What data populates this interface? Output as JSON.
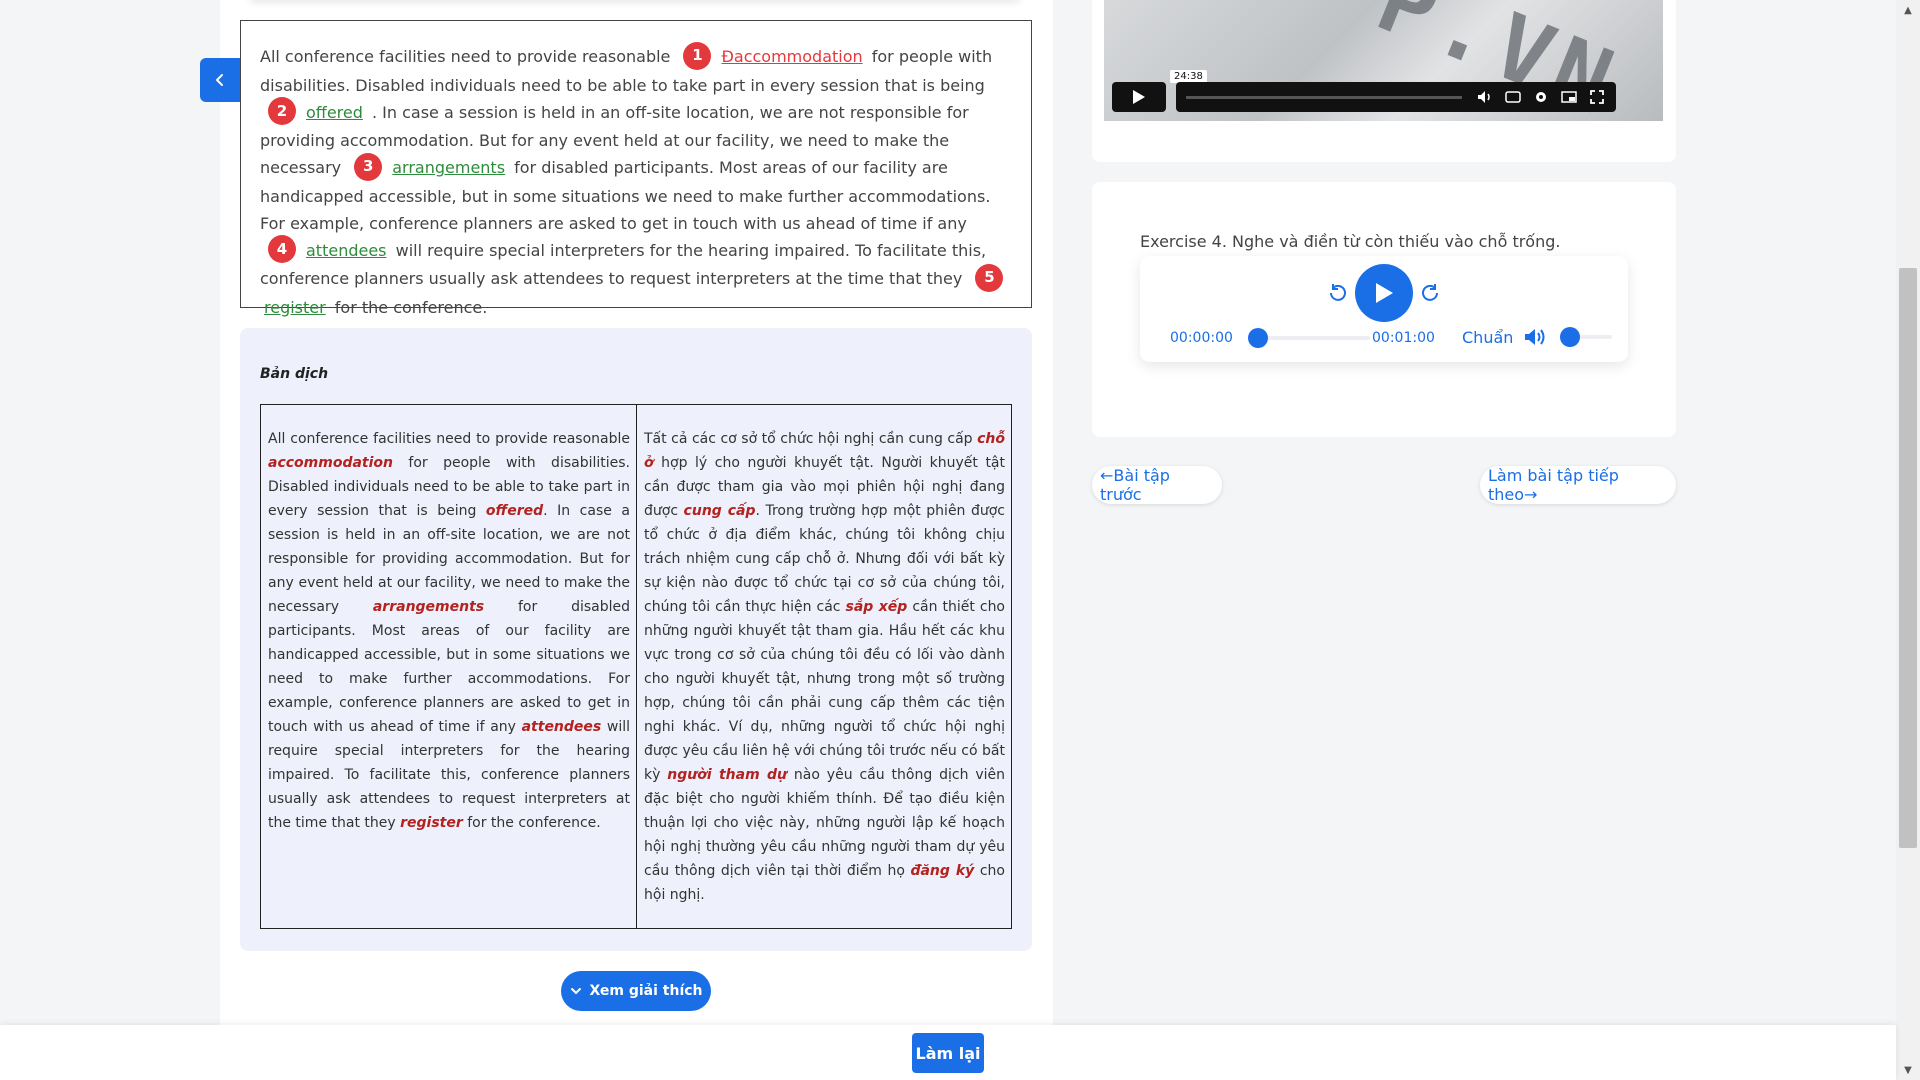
{
  "passage": {
    "segments": [
      {
        "t": "All conference facilities need to provide reasonable "
      },
      {
        "num": "1",
        "ans": "Đaccommodation",
        "status": "error"
      },
      {
        "t": " for people with disabilities. Disabled individuals need to be able to take part in every session that is being "
      },
      {
        "num": "2",
        "ans": "offered",
        "status": "ok"
      },
      {
        "t": " . In case a session is held in an off-site location, we are not responsible for providing accommodation. But for any event held at our facility, we need to make the necessary "
      },
      {
        "num": "3",
        "ans": "arrangements",
        "status": "ok"
      },
      {
        "t": " for disabled participants. Most areas of our facility are handicapped accessible, but in some situations we need to make further accommodations. For example, conference planners are asked to get in touch with us ahead of time if any "
      },
      {
        "num": "4",
        "ans": "attendees",
        "status": "ok"
      },
      {
        "t": " will require special interpreters for the hearing impaired. To facilitate this, conference planners usually ask attendees to request interpreters at the time that they "
      },
      {
        "num": "5",
        "ans": "register",
        "status": "ok"
      },
      {
        "t": " for the conference."
      }
    ]
  },
  "translation": {
    "title": "Bản dịch",
    "english": [
      {
        "t": "All conference facilities need to provide reasonable "
      },
      {
        "h": "accommodation"
      },
      {
        "t": " for people with disabilities. Disabled individuals need to be able to take part in every session that is being "
      },
      {
        "h": "offered"
      },
      {
        "t": ". In case a session is held in an off-site location, we are not responsible for providing accommodation. But for any event held at our facility, we need to make the necessary "
      },
      {
        "h": "arrangements"
      },
      {
        "t": " for disabled participants. Most areas of our facility are handicapped accessible, but in some situations we need to make further accommodations. For example, conference planners are asked to get in touch with us ahead of time if any "
      },
      {
        "h": "attendees"
      },
      {
        "t": " will require special interpreters for the hearing impaired. To facilitate this, conference planners usually ask attendees to request interpreters at the time that they "
      },
      {
        "h": "register"
      },
      {
        "t": " for the conference."
      }
    ],
    "vietnamese": [
      {
        "t": "Tất cả các cơ sở tổ chức hội nghị cần cung cấp "
      },
      {
        "h": "chỗ ở"
      },
      {
        "t": " hợp lý cho người khuyết tật. Người khuyết tật cần được tham gia vào mọi phiên hội nghị đang được "
      },
      {
        "h": "cung cấp"
      },
      {
        "t": ". Trong trường hợp một phiên được tổ chức ở địa điểm khác, chúng tôi không chịu trách nhiệm cung cấp chỗ ở. Nhưng đối với bất kỳ sự kiện nào được tổ chức tại cơ sở của chúng tôi, chúng tôi cần thực hiện các "
      },
      {
        "h": "sắp xếp"
      },
      {
        "t": " cần thiết cho những người khuyết tật tham gia. Hầu hết các khu vực trong cơ sở của chúng tôi đều có lối vào dành cho người khuyết tật, nhưng trong một số trường hợp, chúng tôi cần phải cung cấp thêm các tiện nghi khác. Ví dụ, những người tổ chức hội nghị được yêu cầu liên hệ với chúng tôi trước nếu có bất kỳ "
      },
      {
        "h": "người tham dự"
      },
      {
        "t": " nào yêu cầu thông dịch viên đặc biệt cho người khiếm thính. Để tạo điều kiện thuận lợi cho việc này, những người lập kế hoạch hội nghị thường yêu cầu những người tham dự yêu cầu thông dịch viên tại thời điểm họ "
      },
      {
        "h": "đăng ký"
      },
      {
        "t": " cho hội nghị."
      }
    ]
  },
  "buttons": {
    "explain": "Xem giải thích",
    "retry": "Làm lại",
    "prev": "←Bài tập trước",
    "next": "Làm bài tập tiếp theo→"
  },
  "video": {
    "time_tooltip": "24:38",
    "watermark": "P.VN",
    "progress": 0.0
  },
  "exercise": {
    "title": "Exercise 4. Nghe và điền từ còn thiếu vào chỗ trống.",
    "current_time": "00:00:00",
    "duration": "00:01:00",
    "speed": "Chuẩn",
    "progress": 0.0,
    "volume": 0.0
  },
  "colors": {
    "accent": "#1a6fe6",
    "error": "#e4393c",
    "correct": "#2e8b3b",
    "highlight": "#b3221f"
  }
}
